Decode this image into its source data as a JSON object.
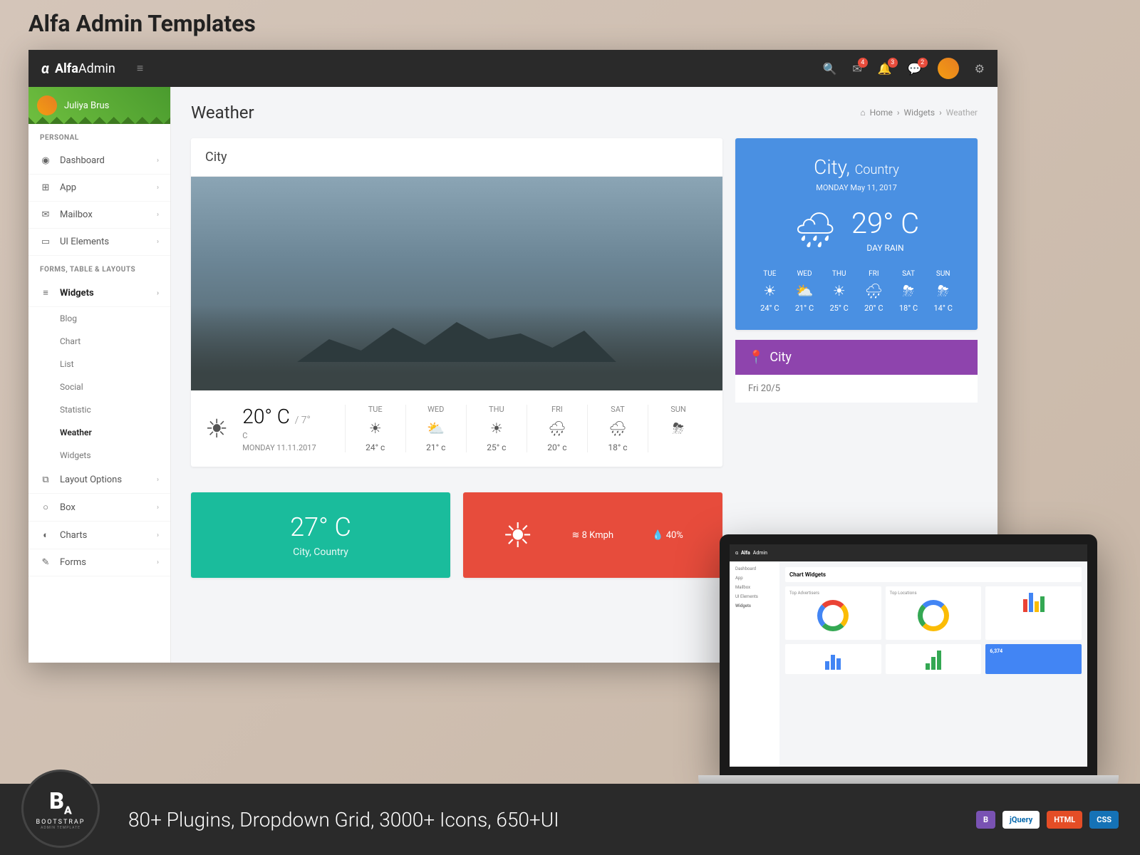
{
  "promo": {
    "title": "Alfa Admin Templates"
  },
  "brand": {
    "alpha": "α",
    "bold": "Alfa",
    "light": "Admin"
  },
  "topbar": {
    "badges": {
      "mail": "4",
      "bell": "3",
      "chat": "2"
    }
  },
  "user": {
    "name": "Juliya Brus"
  },
  "sidebar": {
    "section1": "PERSONAL",
    "section2": "FORMS, TABLE & LAYOUTS",
    "items1": [
      {
        "label": "Dashboard",
        "icon": "◉"
      },
      {
        "label": "App",
        "icon": "⊞"
      },
      {
        "label": "Mailbox",
        "icon": "✉"
      },
      {
        "label": "UI Elements",
        "icon": "▭"
      }
    ],
    "widgets": {
      "label": "Widgets",
      "icon": "≡"
    },
    "subs": [
      "Blog",
      "Chart",
      "List",
      "Social",
      "Statistic",
      "Weather",
      "Widgets"
    ],
    "items2": [
      {
        "label": "Layout Options",
        "icon": "⧉"
      },
      {
        "label": "Box",
        "icon": "○"
      },
      {
        "label": "Charts",
        "icon": "◐"
      },
      {
        "label": "Forms",
        "icon": "✎"
      }
    ]
  },
  "page": {
    "title": "Weather"
  },
  "breadcrumb": {
    "home": "Home",
    "mid": "Widgets",
    "current": "Weather"
  },
  "city_card": {
    "title": "City",
    "temp": "20° C",
    "temp_low": "/ 7°",
    "unit": "C",
    "date": "MONDAY 11.11.2017",
    "forecast": [
      {
        "day": "TUE",
        "icon": "☀",
        "temp": "24° c"
      },
      {
        "day": "WED",
        "icon": "⛅",
        "temp": "21° c"
      },
      {
        "day": "THU",
        "icon": "☀",
        "temp": "25° c"
      },
      {
        "day": "FRI",
        "icon": "🌧",
        "temp": "20° c"
      },
      {
        "day": "SAT",
        "icon": "🌧",
        "temp": "18° c"
      },
      {
        "day": "SUN",
        "icon": "⛈",
        "temp": ""
      }
    ]
  },
  "blue_card": {
    "city": "City,",
    "country": "Country",
    "date": "MONDAY  May 11, 2017",
    "temp": "29° C",
    "cond": "DAY RAIN",
    "forecast": [
      {
        "day": "TUE",
        "icon": "☀",
        "temp": "24° C"
      },
      {
        "day": "WED",
        "icon": "⛅",
        "temp": "21° C"
      },
      {
        "day": "THU",
        "icon": "☀",
        "temp": "25° C"
      },
      {
        "day": "FRI",
        "icon": "🌧",
        "temp": "20° C"
      },
      {
        "day": "SAT",
        "icon": "⛈",
        "temp": "18° C"
      },
      {
        "day": "SUN",
        "icon": "⛈",
        "temp": "14° C"
      }
    ]
  },
  "purple_card": {
    "title": "City",
    "sub": "Fri 20/5"
  },
  "teal_card": {
    "temp": "27° C",
    "loc": "City, Country"
  },
  "red_card": {
    "wind": "8 Kmph",
    "humid": "40%"
  },
  "laptop": {
    "title": "Chart Widgets",
    "big_number": "6,374"
  },
  "footer": {
    "logo_main": "B",
    "logo_sub": "A",
    "logo_text": "BOOTSTRAP",
    "logo_subtext": "ADMIN TEMPLATE",
    "tagline": "80+ Plugins, Dropdown Grid, 3000+ Icons, 650+UI",
    "badges": {
      "bs": "B",
      "jq": "jQuery",
      "html": "HTML",
      "css": "CSS"
    }
  }
}
